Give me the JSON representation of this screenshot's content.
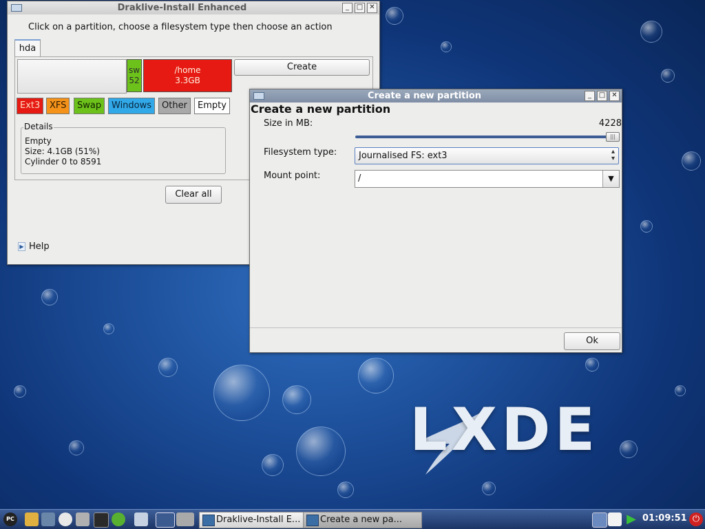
{
  "main_window": {
    "title": "Draklive-Install Enhanced",
    "instruction": "Click on a partition, choose a filesystem type then choose an action",
    "disk_tab": "hda",
    "partitions": [
      {
        "label_line1": "sw",
        "label_line2": "52",
        "color": "#6cc21a"
      },
      {
        "label_line1": "/home",
        "label_line2": "3.3GB",
        "color": "#e61a12"
      }
    ],
    "create_button": "Create",
    "fs_types": [
      {
        "label": "Ext3",
        "color": "#e61a12"
      },
      {
        "label": "XFS",
        "color": "#f4921a"
      },
      {
        "label": "Swap",
        "color": "#6cc21a"
      },
      {
        "label": "Windows",
        "color": "#31a8e8"
      },
      {
        "label": "Other",
        "color": "#a9a9a9"
      },
      {
        "label": "Empty",
        "color": "#ffffff"
      }
    ],
    "details": {
      "legend": "Details",
      "line1": "Empty",
      "line2": "Size: 4.1GB (51%)",
      "line3": "Cylinder 0 to 8591"
    },
    "clear_all_button": "Clear all",
    "help_label": "Help"
  },
  "dialog": {
    "title": "Create a new partition",
    "heading": "Create a new partition",
    "size_label": "Size in MB:",
    "size_value": "4228",
    "size_fraction": 1.0,
    "fs_label": "Filesystem type:",
    "fs_value": "Journalised FS: ext3",
    "mount_label": "Mount point:",
    "mount_value": "/",
    "ok_button": "Ok"
  },
  "desktop": {
    "logo_text": "LXDE"
  },
  "taskbar": {
    "tasks": [
      "Draklive-Install E...",
      "Create a new pa..."
    ],
    "clock": "01:09:51",
    "start_label": "PC"
  }
}
